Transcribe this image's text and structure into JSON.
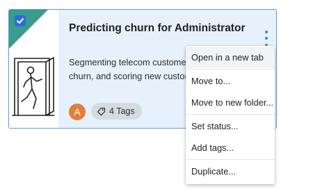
{
  "card": {
    "title": "Predicting churn for Administrator",
    "description_lines": [
      "Segmenting telecom customers",
      "churn, and scoring new custom"
    ],
    "selected": true,
    "avatar_initial": "A",
    "tags_label": "4 Tags",
    "colors": {
      "border": "#5b9bd8",
      "background": "#e6f1fc",
      "corner": "#3a9b8f",
      "checkbox": "#2b6fd6",
      "avatar": "#e17f3a"
    }
  },
  "context_menu": {
    "items": [
      {
        "label": "Open in a new tab",
        "highlighted": true
      },
      {
        "label": "Move to..."
      },
      {
        "label": "Move to new folder..."
      },
      {
        "label": "Set status..."
      },
      {
        "label": "Add tags..."
      },
      {
        "label": "Duplicate..."
      }
    ]
  },
  "icons": {
    "checkbox": "checkbox-checked-icon",
    "illustration": "door-exit-person-icon",
    "menu": "kebab-menu-icon",
    "tag": "tag-icon"
  }
}
